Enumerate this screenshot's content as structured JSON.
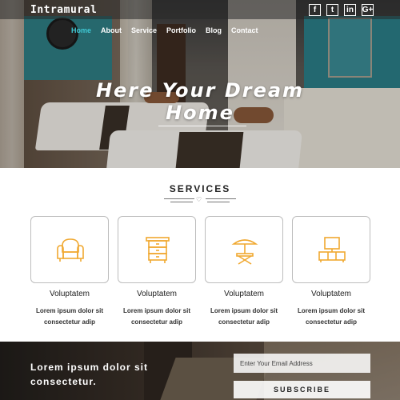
{
  "brand": "Intramural",
  "social": [
    {
      "icon": "facebook-icon",
      "glyph": "f"
    },
    {
      "icon": "twitter-icon",
      "glyph": "t"
    },
    {
      "icon": "linkedin-icon",
      "glyph": "in"
    },
    {
      "icon": "google-plus-icon",
      "glyph": "G+"
    }
  ],
  "nav": [
    "Home",
    "About",
    "Service",
    "Portfolio",
    "Blog",
    "Contact"
  ],
  "hero": {
    "title_line1": "Here Your Dream",
    "title_line2": "Home"
  },
  "services": {
    "title": "SERVICES",
    "items": [
      {
        "icon": "armchair-icon",
        "title": "Voluptatem",
        "desc_line1": "Lorem ipsum dolor sit",
        "desc_line2": "consectetur adip"
      },
      {
        "icon": "cabinet-icon",
        "title": "Voluptatem",
        "desc_line1": "Lorem ipsum dolor sit",
        "desc_line2": "consectetur adip"
      },
      {
        "icon": "patio-table-icon",
        "title": "Voluptatem",
        "desc_line1": "Lorem ipsum dolor sit",
        "desc_line2": "consectetur adip"
      },
      {
        "icon": "tv-stand-icon",
        "title": "Voluptatem",
        "desc_line1": "Lorem ipsum dolor sit",
        "desc_line2": "consectetur adip"
      }
    ]
  },
  "newsletter": {
    "text_line1": "Lorem ipsum dolor sit",
    "text_line2": "consectetur.",
    "email_placeholder": "Enter Your Email Address",
    "button": "SUBSCRIBE"
  },
  "colors": {
    "accent": "#3fc7d3",
    "icon": "#f0a830"
  }
}
